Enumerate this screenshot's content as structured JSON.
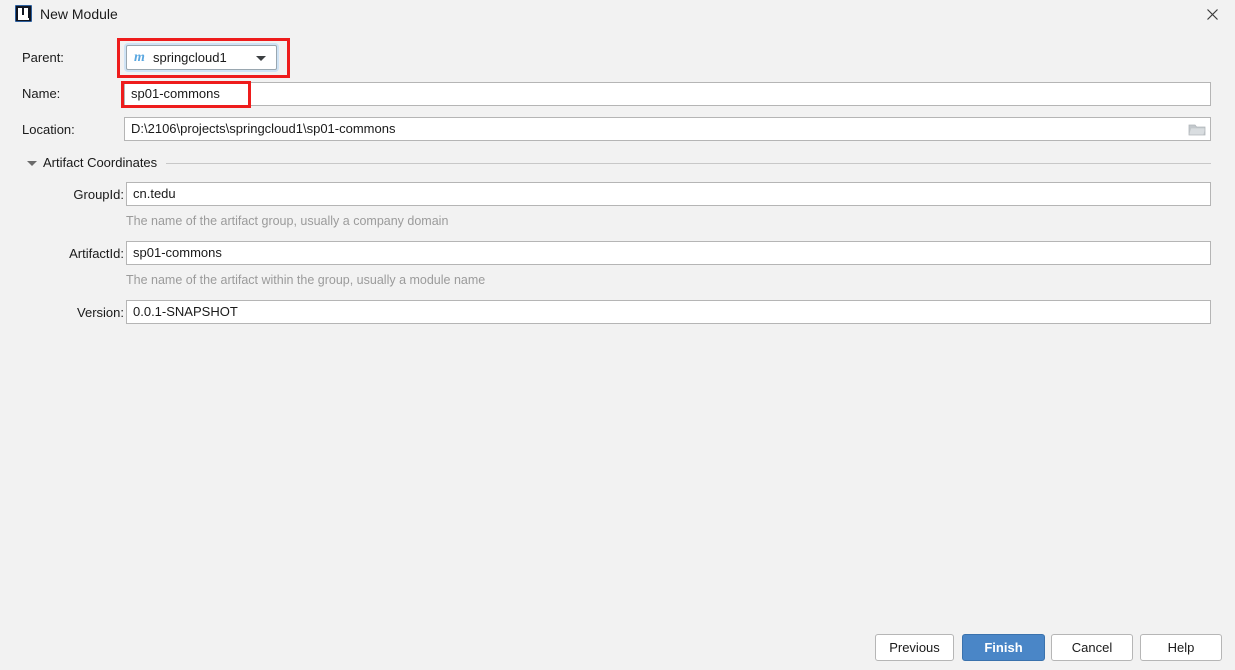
{
  "window": {
    "title": "New Module",
    "app_icon": "intellij-idea-icon",
    "close_icon": "close-icon"
  },
  "form": {
    "parent": {
      "label": "Parent:",
      "value": "springcloud1",
      "icon": "maven-module-icon",
      "dropdown_icon": "chevron-down-icon"
    },
    "name": {
      "label": "Name:",
      "value": "sp01-commons",
      "placeholder": ""
    },
    "location": {
      "label": "Location:",
      "value": "D:\\2106\\projects\\springcloud1\\sp01-commons",
      "placeholder": "",
      "browse_icon": "folder-icon"
    }
  },
  "artifact_section": {
    "title": "Artifact Coordinates",
    "expanded": true,
    "collapse_icon": "triangle-down-icon",
    "fields": {
      "group_id": {
        "label": "GroupId:",
        "value": "cn.tedu",
        "hint": "The name of the artifact group, usually a company domain"
      },
      "artifact_id": {
        "label": "ArtifactId:",
        "value": "sp01-commons",
        "hint": "The name of the artifact within the group, usually a module name"
      },
      "version": {
        "label": "Version:",
        "value": "0.0.1-SNAPSHOT",
        "hint": ""
      }
    }
  },
  "buttons": {
    "previous": "Previous",
    "finish": "Finish",
    "cancel": "Cancel",
    "help": "Help"
  },
  "annotations": {
    "highlight_color": "#ee1c1c",
    "boxes": [
      "parent-combo-highlight",
      "name-field-highlight"
    ]
  },
  "colors": {
    "background": "#f2f2f2",
    "field_background": "#ffffff",
    "field_border": "#b5b5b5",
    "primary_button": "#4a86c7",
    "hint_text": "#9b9b9b",
    "focus_ring": "#cfe3f5",
    "maven_icon": "#5aa7e0"
  }
}
